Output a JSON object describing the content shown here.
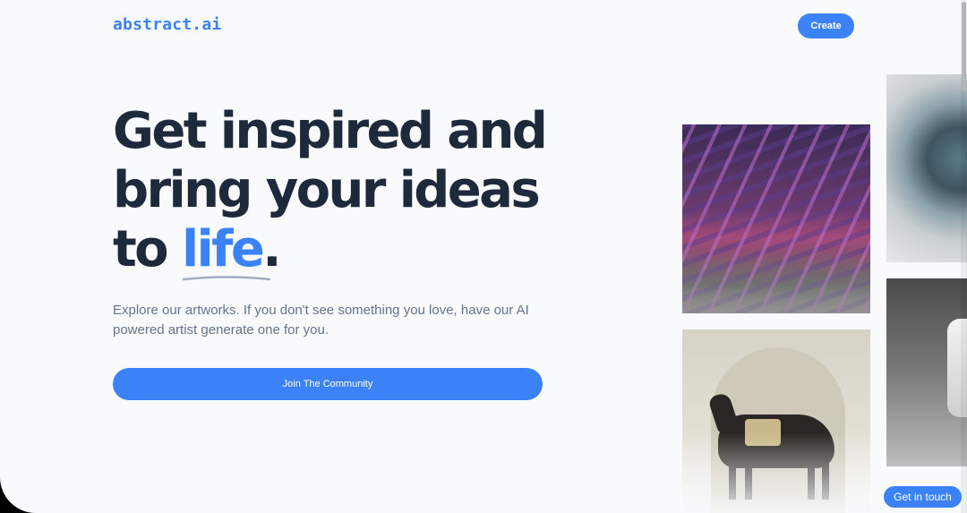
{
  "header": {
    "logo": "abstract.ai",
    "create_label": "Create"
  },
  "hero": {
    "line1": "Get inspired and",
    "line2": "bring your ideas",
    "line3_prefix": "to ",
    "line3_accent": "life",
    "line3_suffix": "."
  },
  "subtitle": "Explore our artworks. If you don't see something you love, have our AI powered artist generate one for you.",
  "join_label": "Join The Community",
  "contact_label": "Get in touch",
  "colors": {
    "accent": "#3b82f6",
    "heading": "#1e293b",
    "body_text": "#64748b",
    "background": "#f8fafc"
  },
  "icons": []
}
